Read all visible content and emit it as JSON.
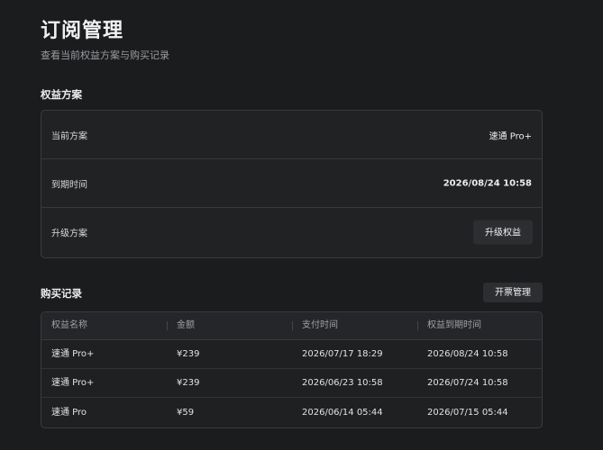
{
  "header": {
    "title": "订阅管理",
    "subtitle": "查看当前权益方案与购买记录"
  },
  "plan_section": {
    "title": "权益方案",
    "rows": [
      {
        "label": "当前方案",
        "value": "速通 Pro+"
      },
      {
        "label": "到期时间",
        "value": "2026/08/24 10:58"
      },
      {
        "label": "升级方案",
        "button_label": "升级权益"
      }
    ]
  },
  "purchase_section": {
    "title": "购买记录",
    "invoice_button": "开票管理",
    "columns": [
      "权益名称",
      "金额",
      "支付时间",
      "权益到期时间"
    ],
    "rows": [
      {
        "name": "速通 Pro+",
        "amount": "¥239",
        "paid_at": "2026/07/17 18:29",
        "expires_at": "2026/08/24 10:58"
      },
      {
        "name": "速通 Pro+",
        "amount": "¥239",
        "paid_at": "2026/06/23 10:58",
        "expires_at": "2026/07/24 10:58"
      },
      {
        "name": "速通 Pro",
        "amount": "¥59",
        "paid_at": "2026/06/14 05:44",
        "expires_at": "2026/07/15 05:44"
      }
    ]
  },
  "colors": {
    "background": "#1b1c1e",
    "card": "#212224",
    "border": "#3a3b3e",
    "button": "#2d2e31"
  }
}
